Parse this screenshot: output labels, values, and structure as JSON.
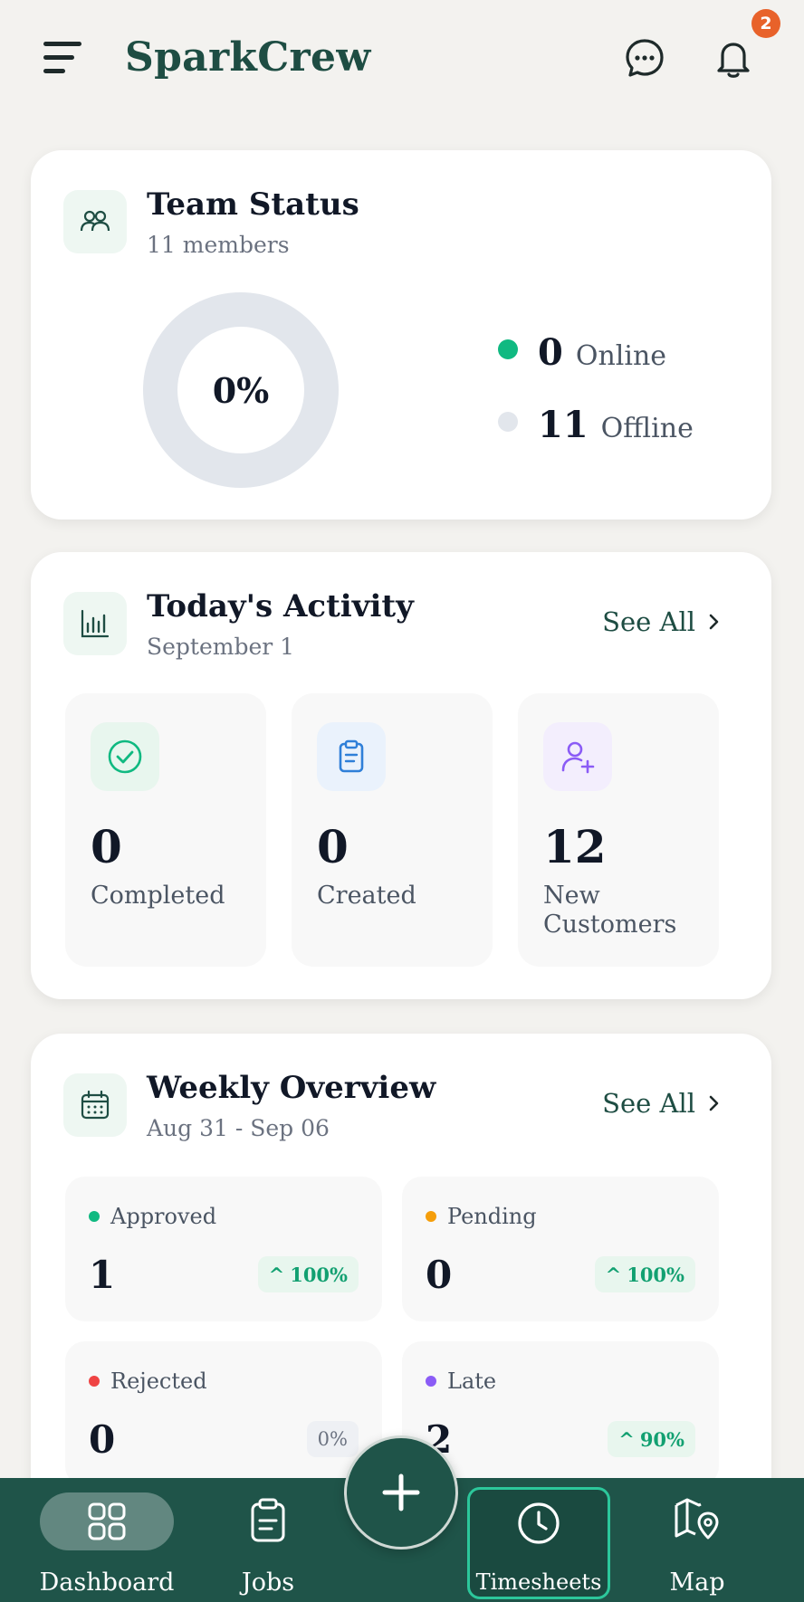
{
  "header": {
    "brand": "SparkCrew",
    "notification_count": "2"
  },
  "team_status": {
    "title": "Team Status",
    "subtitle": "11 members",
    "online_percent": "0%",
    "online_fraction": 0,
    "online_count": "0",
    "online_label": "Online",
    "offline_count": "11",
    "offline_label": "Offline",
    "colors": {
      "online": "#10b981",
      "offline": "#e2e6ec"
    }
  },
  "activity": {
    "title": "Today's Activity",
    "subtitle": "September 1",
    "see_all": "See All",
    "tiles": [
      {
        "icon": "check-circle-icon",
        "value": "0",
        "label": "Completed"
      },
      {
        "icon": "clipboard-icon",
        "value": "0",
        "label": "Created"
      },
      {
        "icon": "user-plus-icon",
        "value": "12",
        "label": "New Customers"
      }
    ]
  },
  "weekly": {
    "title": "Weekly Overview",
    "subtitle": "Aug 31 - Sep 06",
    "see_all": "See All",
    "tiles": [
      {
        "label": "Approved",
        "value": "1",
        "change": "100%",
        "dot": "#10b981"
      },
      {
        "label": "Pending",
        "value": "0",
        "change": "100%",
        "dot": "#f59e0b"
      },
      {
        "label": "Rejected",
        "value": "0",
        "change": "0%",
        "dot": "#ef4444"
      },
      {
        "label": "Late",
        "value": "2",
        "change": "90%",
        "dot": "#8b5cf6"
      }
    ]
  },
  "nav": {
    "dashboard": "Dashboard",
    "jobs": "Jobs",
    "timesheets": "Timesheets",
    "map": "Map"
  }
}
